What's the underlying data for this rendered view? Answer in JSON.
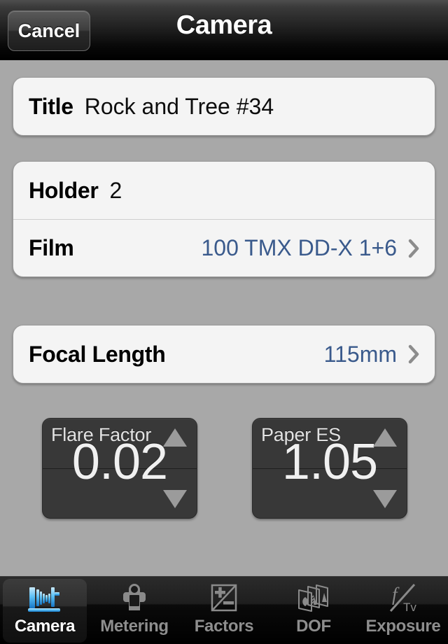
{
  "navbar": {
    "cancel_label": "Cancel",
    "title": "Camera"
  },
  "form": {
    "title_row": {
      "label": "Title",
      "value": "Rock and Tree #34"
    },
    "holder_row": {
      "label": "Holder",
      "value": "2"
    },
    "film_row": {
      "label": "Film",
      "value": "100 TMX DD-X 1+6"
    },
    "focal_row": {
      "label": "Focal Length",
      "value": "115mm"
    }
  },
  "steppers": [
    {
      "label": "Flare Factor",
      "value": "0.02"
    },
    {
      "label": "Paper ES",
      "value": "1.05"
    }
  ],
  "tabbar": {
    "items": [
      {
        "label": "Camera",
        "icon": "view-camera-icon",
        "selected": true
      },
      {
        "label": "Metering",
        "icon": "light-meter-icon",
        "selected": false
      },
      {
        "label": "Factors",
        "icon": "plus-minus-icon",
        "selected": false
      },
      {
        "label": "DOF",
        "icon": "photo-stack-icon",
        "selected": false
      },
      {
        "label": "Exposure",
        "icon": "f-over-tv-icon",
        "selected": false
      }
    ]
  },
  "colors": {
    "background": "#a8a8a8",
    "card": "#f4f4f4",
    "accent_blue": "#3a5a8c",
    "stepper_bg": "#383838",
    "tab_selected_text": "#ffffff",
    "tab_text": "#8e8e8e",
    "camera_icon_blue": "#3aa8f0"
  }
}
